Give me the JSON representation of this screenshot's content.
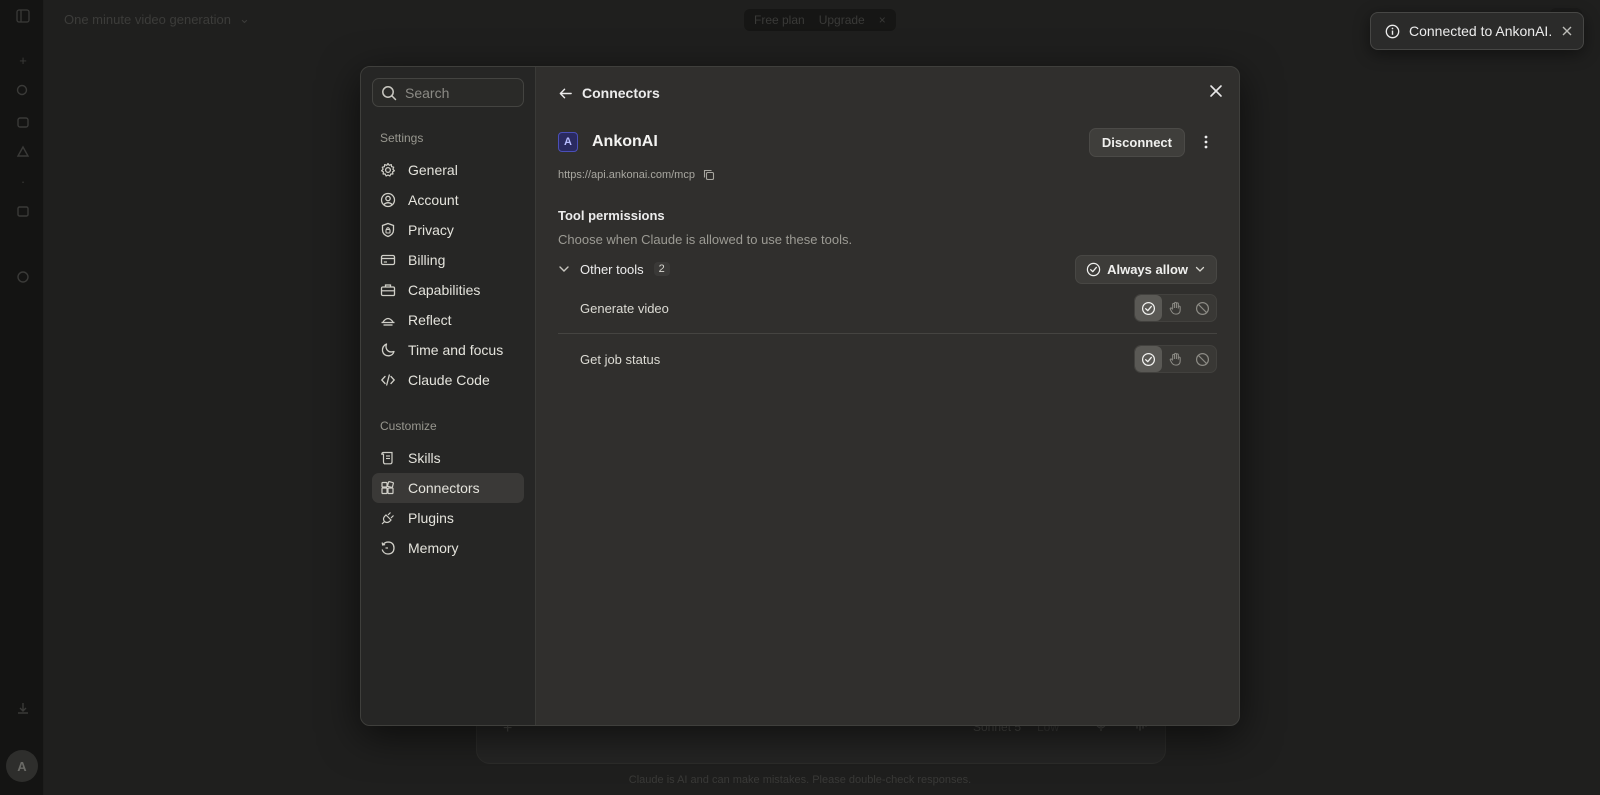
{
  "background": {
    "chat_title": "One minute video generation",
    "plan_label": "Free plan",
    "upgrade_label": "Upgrade",
    "model_label": "Sonnet 5",
    "effort_label": "Low",
    "disclaimer": "Claude is AI and can make mistakes. Please double-check responses.",
    "avatar_initial": "A"
  },
  "toast": {
    "message": "Connected to AnkonAI.",
    "icon": "info-icon"
  },
  "sidebar": {
    "search_placeholder": "Search",
    "settings_heading": "Settings",
    "settings_items": [
      {
        "label": "General",
        "icon": "gear-icon"
      },
      {
        "label": "Account",
        "icon": "user-circle-icon"
      },
      {
        "label": "Privacy",
        "icon": "shield-lock-icon"
      },
      {
        "label": "Billing",
        "icon": "credit-card-icon"
      },
      {
        "label": "Capabilities",
        "icon": "toolbox-icon"
      },
      {
        "label": "Reflect",
        "icon": "sunrise-icon"
      },
      {
        "label": "Time and focus",
        "icon": "moon-icon"
      },
      {
        "label": "Claude Code",
        "icon": "code-icon"
      }
    ],
    "customize_heading": "Customize",
    "customize_items": [
      {
        "label": "Skills",
        "icon": "scroll-icon"
      },
      {
        "label": "Connectors",
        "icon": "connectors-icon",
        "active": true
      },
      {
        "label": "Plugins",
        "icon": "plug-icon"
      },
      {
        "label": "Memory",
        "icon": "history-icon"
      }
    ]
  },
  "main": {
    "back_title": "Connectors",
    "connector": {
      "name": "AnkonAI",
      "logo_letter": "A",
      "url": "https://api.ankonai.com/mcp",
      "disconnect_label": "Disconnect"
    },
    "permissions": {
      "title": "Tool permissions",
      "description": "Choose when Claude is allowed to use these tools.",
      "group_name": "Other tools",
      "group_count": "2",
      "group_mode": "Always allow",
      "tools": [
        {
          "name": "Generate video",
          "selected": "allow"
        },
        {
          "name": "Get job status",
          "selected": "allow"
        }
      ]
    }
  },
  "colors": {
    "modal_bg": "#302f2d",
    "sidebar_bg": "#262625",
    "active_item_bg": "#3a3937",
    "logo_accent": "#4a4fb8"
  }
}
